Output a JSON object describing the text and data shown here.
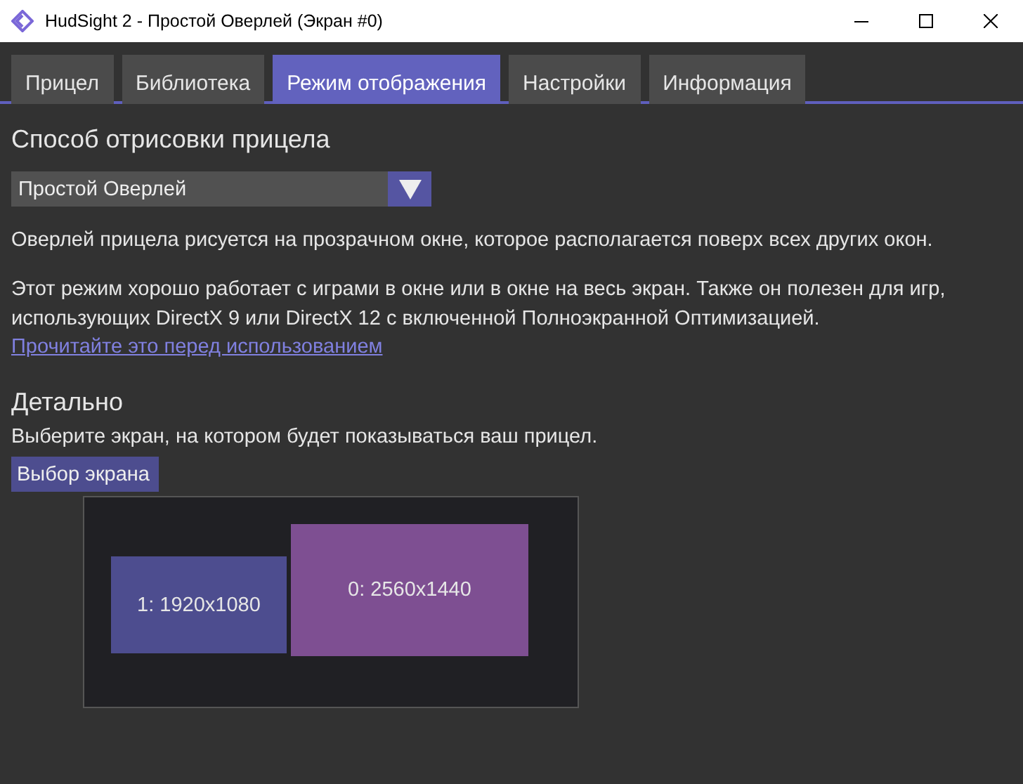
{
  "window": {
    "title": "HudSight 2 - Простой Оверлей (Экран #0)"
  },
  "tabs": [
    {
      "label": "Прицел",
      "selected": false
    },
    {
      "label": "Библиотека",
      "selected": false
    },
    {
      "label": "Режим отображения",
      "selected": true
    },
    {
      "label": "Настройки",
      "selected": false
    },
    {
      "label": "Информация",
      "selected": false
    }
  ],
  "render_mode": {
    "heading": "Способ отрисовки прицела",
    "dropdown": {
      "value": "Простой Оверлей"
    },
    "paragraphs": [
      "Оверлей прицела рисуется на прозрачном окне, которое располагается поверх всех других окон.",
      "Этот режим хорошо работает с играми в окне или в окне на весь экран. Также он полезен для игр, использующих DirectX 9 или DirectX 12 с включенной Полноэкранной Оптимизацией."
    ],
    "link": "Прочитайте это перед использованием"
  },
  "details": {
    "heading": "Детально",
    "text": "Выберите экран, на котором будет показываться ваш прицел.",
    "button": "Выбор экрана"
  },
  "screen_picker": {
    "monitors": [
      {
        "label": "1: 1920x1080",
        "color": "#4d4d8f"
      },
      {
        "label": "0: 2560x1440",
        "color": "#7e4f92"
      }
    ]
  }
}
